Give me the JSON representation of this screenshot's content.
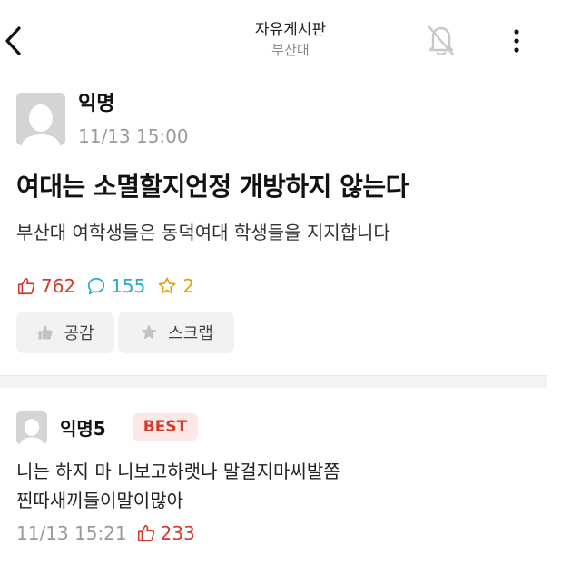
{
  "header": {
    "title": "자유게시판",
    "subtitle": "부산대",
    "back_icon": "chevron-left-icon",
    "notification_icon": "bell-off-icon",
    "more_icon": "more-vertical-icon"
  },
  "post": {
    "author": "익명",
    "time": "11/13 15:00",
    "title": "여대는 소멸할지언정 개방하지 않는다",
    "body": "부산대 여학생들은 동덕여대 학생들을 지지합니다",
    "stats": {
      "likes": "762",
      "comments": "155",
      "scraps": "2"
    },
    "actions": {
      "like_label": "공감",
      "scrap_label": "스크랩"
    }
  },
  "comment": {
    "author": "익명5",
    "badge": "BEST",
    "lines": [
      "니는 하지 마 니보고하랫나 말걸지마씨발쫌",
      "찐따새끼들이말이많아"
    ],
    "time": "11/13 15:21",
    "likes": "233"
  },
  "colors": {
    "like": "#d43b2e",
    "comment": "#2aa7c9",
    "scrap": "#d9a800",
    "muted": "#9a9a9a",
    "button_bg": "#f2f2f2"
  }
}
